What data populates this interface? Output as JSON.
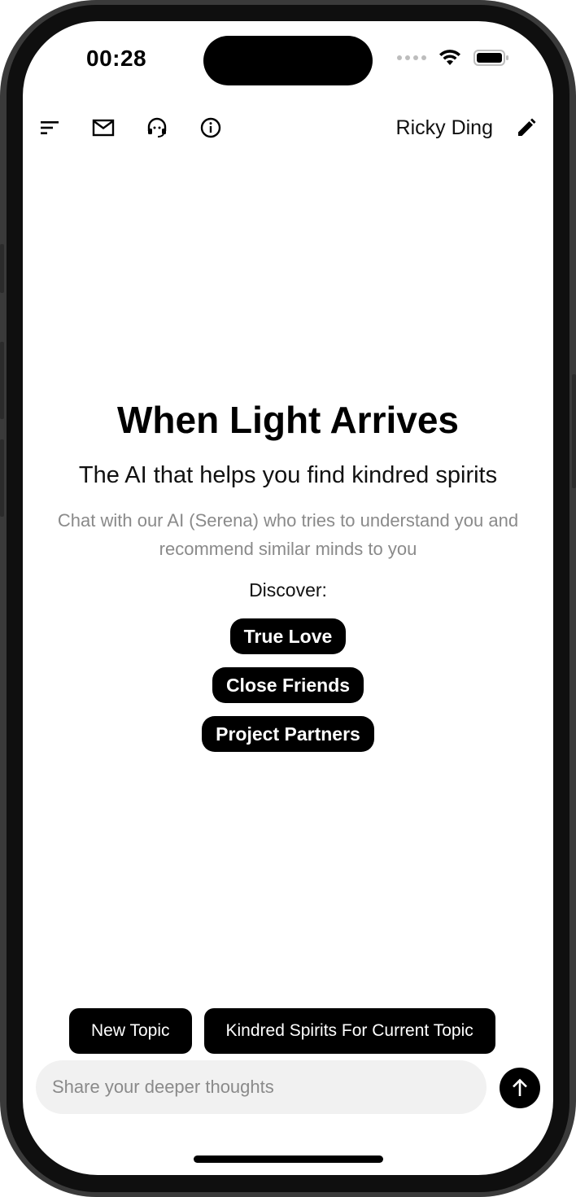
{
  "status_bar": {
    "time": "00:28"
  },
  "top_bar": {
    "icons": [
      "sort-icon",
      "mail-icon",
      "support-icon",
      "info-icon",
      "edit-icon"
    ],
    "user_name": "Ricky Ding"
  },
  "hero": {
    "title": "When Light Arrives",
    "subtitle": "The AI that helps you find kindred spirits",
    "description": "Chat with our AI (Serena) who tries to understand you and recommend similar minds to you",
    "discover_label": "Discover:",
    "options": [
      "True Love",
      "Close Friends",
      "Project Partners"
    ]
  },
  "actions": {
    "new_topic": "New Topic",
    "kindred_spirits": "Kindred Spirits For Current Topic"
  },
  "composer": {
    "placeholder": "Share your deeper thoughts",
    "value": ""
  },
  "colors": {
    "accent": "#000000",
    "background": "#ffffff",
    "muted_text": "#8a8a8a",
    "input_background": "#f1f1f1"
  }
}
